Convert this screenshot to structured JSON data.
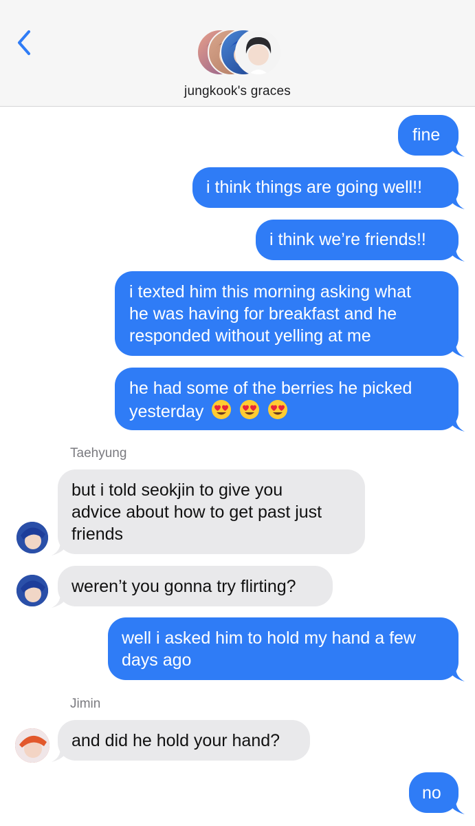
{
  "header": {
    "group_name": "jungkook's graces",
    "back_icon": "chevron-left-icon"
  },
  "colors": {
    "outgoing": "#2f7cf6",
    "incoming": "#e9e9eb",
    "back": "#2f7cf6"
  },
  "messages": [
    {
      "dir": "out",
      "text": "fine"
    },
    {
      "dir": "out",
      "text": "i think things are going well!!"
    },
    {
      "dir": "out",
      "text": "i think we’re friends!!"
    },
    {
      "dir": "out",
      "lines": [
        "i texted him this morning asking what",
        "he was having for breakfast and he",
        "responded without yelling at me"
      ]
    },
    {
      "dir": "out",
      "lines": [
        "he had some of the berries he picked",
        "yesterday"
      ],
      "emoji": "heart-eyes-emoji x3"
    },
    {
      "sender": "Taehyung"
    },
    {
      "dir": "in",
      "lines": [
        "but i told seokjin to give you",
        "advice about how to get past just",
        "friends"
      ]
    },
    {
      "dir": "in",
      "text": "weren’t you gonna try flirting?"
    },
    {
      "dir": "out",
      "lines": [
        "well i asked him to hold my hand a few",
        "days ago"
      ]
    },
    {
      "sender": "Jimin"
    },
    {
      "dir": "in",
      "text": "and did he hold your hand?"
    },
    {
      "dir": "out",
      "text": "no"
    }
  ]
}
